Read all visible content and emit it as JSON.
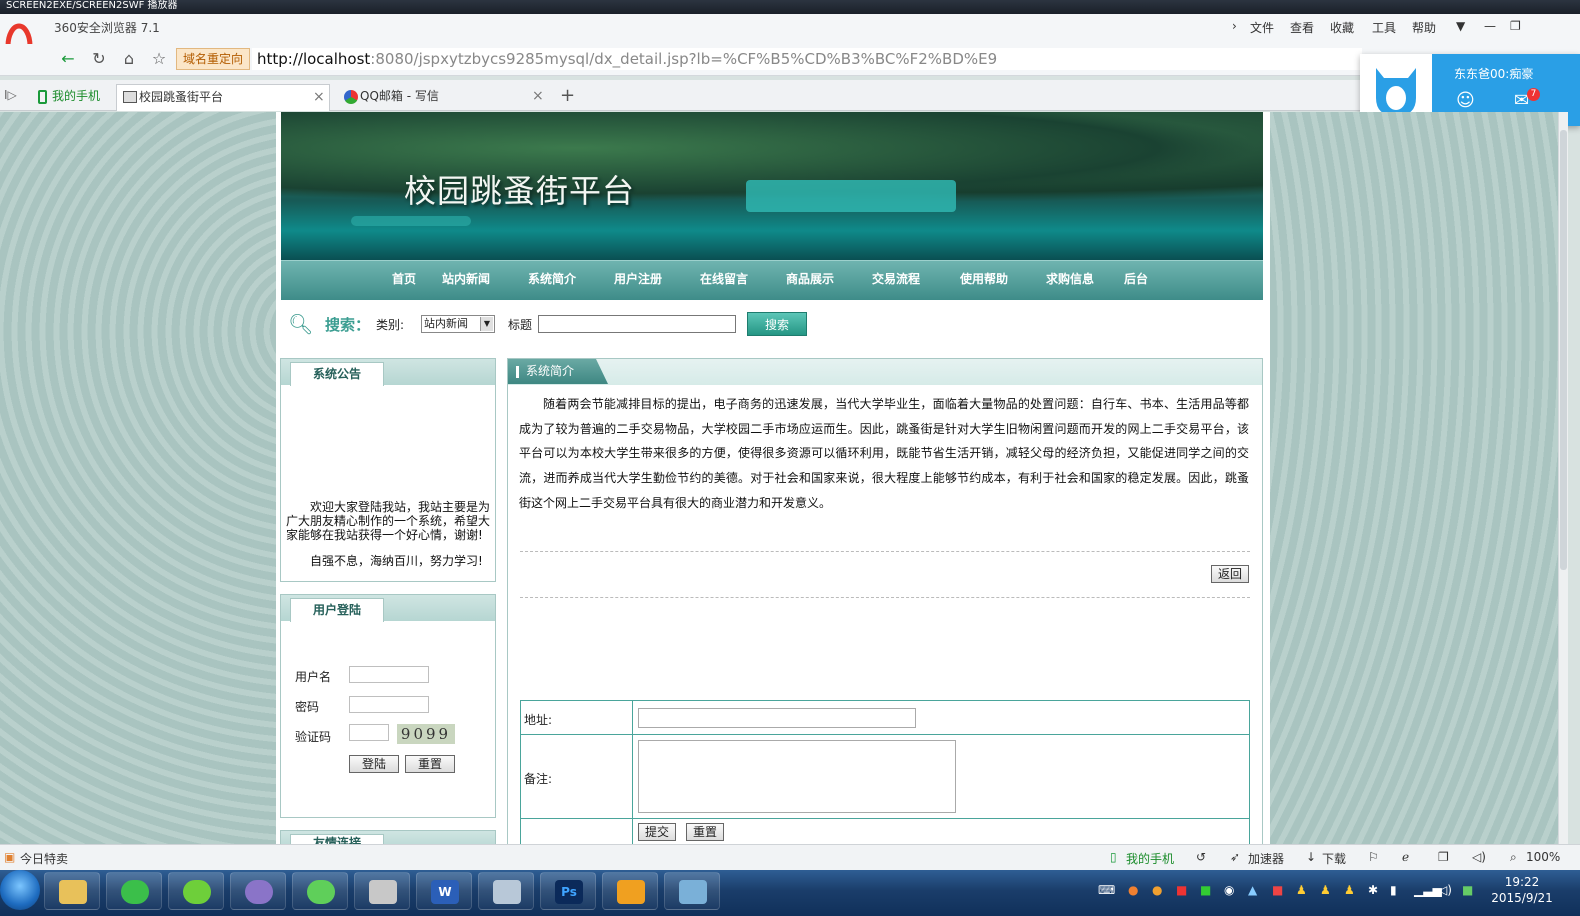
{
  "recorder": {
    "title": "SCREEN2EXE/SCREEN2SWF 播放器"
  },
  "browser": {
    "title": "360安全浏览器 7.1",
    "menu": [
      "文件",
      "查看",
      "收藏",
      "工具",
      "帮助"
    ],
    "redirect_label": "域名重定向",
    "url_host": "http://localhost",
    "url_rest": ":8080/jspxytzbycs9285mysql/dx_detail.jsp?lb=%CF%B5%CD%B3%BC%F2%BD%E9",
    "tabs": [
      {
        "label": "我的手机"
      },
      {
        "label": "校园跳蚤街平台",
        "active": true
      },
      {
        "label": "QQ邮箱 - 写信"
      }
    ],
    "new_tab": "+",
    "close": "×"
  },
  "popup": {
    "name": "东东爸00:痴豪",
    "mail_count": "7"
  },
  "site": {
    "title": "校园跳蚤街平台",
    "nav": [
      "首页",
      "站内新闻",
      "系统简介",
      "用户注册",
      "在线留言",
      "商品展示",
      "交易流程",
      "使用帮助",
      "求购信息",
      "后台"
    ],
    "search": {
      "label": "搜索：",
      "category_label": "类别:",
      "category_value": "站内新闻",
      "title_label": "标题",
      "button": "搜索"
    },
    "notice": {
      "heading": "系统公告",
      "text": "欢迎大家登陆我站，我站主要是为广大朋友精心制作的一个系统，希望大家能够在我站获得一个好心情，谢谢!",
      "motto": "自强不息，海纳百川，努力学习!"
    },
    "login": {
      "heading": "用户登陆",
      "username_label": "用户名",
      "password_label": "密码",
      "captcha_label": "验证码",
      "captcha_value": "9099",
      "login_button": "登陆",
      "reset_button": "重置"
    },
    "links": {
      "heading": "友情连接"
    },
    "main": {
      "heading": "系统简介",
      "intro": "随着两会节能减排目标的提出，电子商务的迅速发展，当代大学毕业生，面临着大量物品的处置问题：自行车、书本、生活用品等都成为了较为普遍的二手交易物品，大学校园二手市场应运而生。因此，跳蚤街是针对大学生旧物闲置问题而开发的网上二手交易平台，该平台可以为本校大学生带来很多的方便，使得很多资源可以循环利用，既能节省生活开销，减轻父母的经济负担，又能促进同学之间的交流，进而养成当代大学生勤俭节约的美德。对于社会和国家来说，很大程度上能够节约成本，有利于社会和国家的稳定发展。因此，跳蚤街这个网上二手交易平台具有很大的商业潜力和开发意义。",
      "back_button": "返回",
      "form": {
        "address_label": "地址:",
        "note_label": "备注:",
        "submit_button": "提交",
        "reset_button": "重置"
      }
    }
  },
  "statusbar": {
    "left": "今日特卖",
    "phone": "我的手机",
    "accelerator": "加速器",
    "download": "下载",
    "zoom": "100%"
  },
  "taskbar": {
    "time": "19:22",
    "date": "2015/9/21"
  }
}
